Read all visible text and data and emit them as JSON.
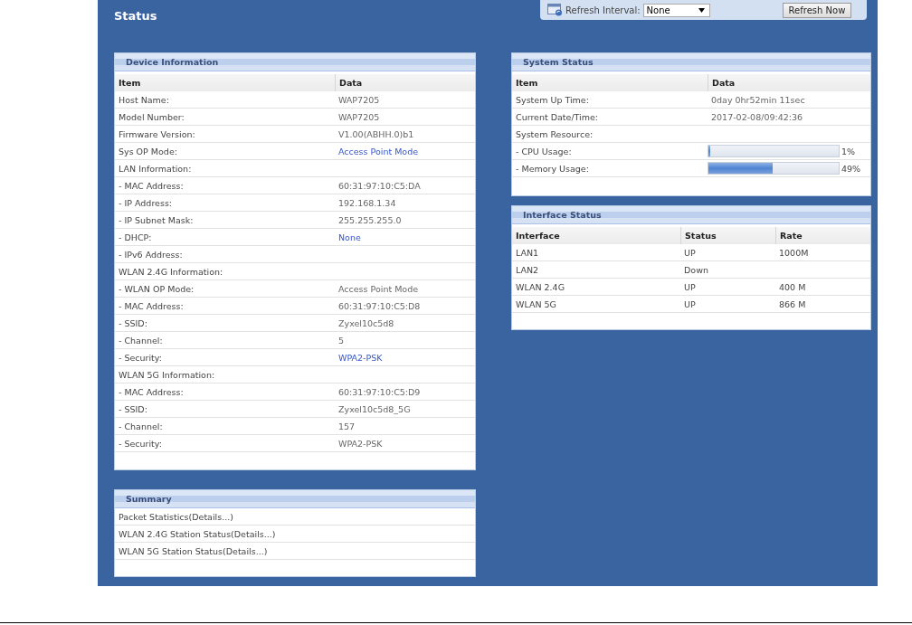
{
  "title": "Status",
  "refresh": {
    "label": "Refresh Interval:",
    "value": "None",
    "button": "Refresh Now"
  },
  "device_information": {
    "title": "Device Information",
    "columns": [
      "Item",
      "Data"
    ],
    "rows": [
      {
        "item": "Host Name:",
        "data": "WAP7205",
        "link": false
      },
      {
        "item": "Model Number:",
        "data": "WAP7205",
        "link": false
      },
      {
        "item": "Firmware Version:",
        "data": "V1.00(ABHH.0)b1",
        "link": false
      },
      {
        "item": "Sys OP Mode:",
        "data": "Access Point Mode",
        "link": true
      },
      {
        "item": "LAN Information:"
      },
      {
        "item": " - MAC Address:",
        "data": "60:31:97:10:C5:DA",
        "link": false
      },
      {
        "item": " - IP Address:",
        "data": "192.168.1.34",
        "link": false
      },
      {
        "item": " - IP Subnet Mask:",
        "data": "255.255.255.0",
        "link": false
      },
      {
        "item": " - DHCP:",
        "data": "None",
        "link": true
      },
      {
        "item": " - IPv6 Address:"
      },
      {
        "item": "WLAN 2.4G Information:"
      },
      {
        "item": " - WLAN OP Mode:",
        "data": "Access Point Mode",
        "link": false
      },
      {
        "item": " - MAC Address:",
        "data": "60:31:97:10:C5:D8",
        "link": false
      },
      {
        "item": " - SSID:",
        "data": "Zyxel10c5d8",
        "link": false
      },
      {
        "item": " - Channel:",
        "data": "5",
        "link": false
      },
      {
        "item": " - Security:",
        "data": "WPA2-PSK",
        "link": true
      },
      {
        "item": "WLAN 5G Information:"
      },
      {
        "item": " - MAC Address:",
        "data": "60:31:97:10:C5:D9",
        "link": false
      },
      {
        "item": " - SSID:",
        "data": "Zyxel10c5d8_5G",
        "link": false
      },
      {
        "item": " - Channel:",
        "data": "157",
        "link": false
      },
      {
        "item": " - Security:",
        "data": "WPA2-PSK",
        "link": false
      }
    ]
  },
  "summary": {
    "title": "Summary",
    "rows": [
      "Packet Statistics(Details...)",
      "WLAN 2.4G Station Status(Details...)",
      "WLAN 5G Station Status(Details...)"
    ]
  },
  "system_status": {
    "title": "System Status",
    "columns": [
      "Item",
      "Data"
    ],
    "rows": [
      {
        "kind": "text",
        "item": "System Up Time:",
        "data": "0day 0hr52min 11sec"
      },
      {
        "kind": "text",
        "item": "Current Date/Time:",
        "data": "2017-02-08/09:42:36"
      },
      {
        "kind": "text",
        "item": "System Resource:"
      },
      {
        "kind": "meter",
        "item": " - CPU Usage:",
        "level": 0.01,
        "reading": "1%"
      },
      {
        "kind": "meter",
        "item": " - Memory Usage:",
        "level": 0.49,
        "reading": "49%"
      }
    ]
  },
  "interface_status": {
    "title": "Interface Status",
    "columns": [
      "Interface",
      "Status",
      "Rate"
    ],
    "rows": [
      [
        "LAN1",
        "UP",
        "1000M"
      ],
      [
        "LAN2",
        "Down",
        ""
      ],
      [
        "WLAN 2.4G",
        "UP",
        "400 M"
      ],
      [
        "WLAN 5G",
        "UP",
        "866 M"
      ]
    ]
  }
}
